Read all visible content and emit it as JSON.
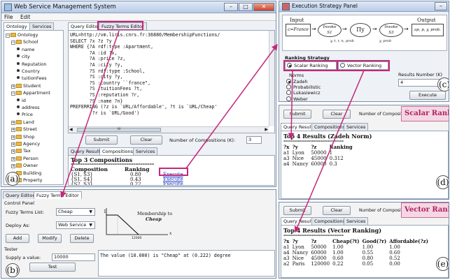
{
  "main_window": {
    "title": "Web Service Management System",
    "menu": [
      "File",
      "Edit"
    ],
    "left_tabs": [
      "Ontology",
      "Services"
    ],
    "tree": [
      {
        "label": "Ontology",
        "level": 0,
        "kind": "folder"
      },
      {
        "label": "School",
        "level": 1,
        "kind": "folder"
      },
      {
        "label": "name",
        "level": 2,
        "kind": "leaf"
      },
      {
        "label": "city",
        "level": 2,
        "kind": "leaf"
      },
      {
        "label": "Reputation",
        "level": 2,
        "kind": "leaf"
      },
      {
        "label": "Country",
        "level": 2,
        "kind": "leaf"
      },
      {
        "label": "tuitionFees",
        "level": 2,
        "kind": "leaf"
      },
      {
        "label": "Student",
        "level": 1,
        "kind": "folder"
      },
      {
        "label": "Appartment",
        "level": 1,
        "kind": "folder"
      },
      {
        "label": "id",
        "level": 2,
        "kind": "leaf"
      },
      {
        "label": "address",
        "level": 2,
        "kind": "leaf"
      },
      {
        "label": "Price",
        "level": 2,
        "kind": "leaf"
      },
      {
        "label": "Land",
        "level": 1,
        "kind": "folder"
      },
      {
        "label": "Street",
        "level": 1,
        "kind": "folder"
      },
      {
        "label": "Shop",
        "level": 1,
        "kind": "folder"
      },
      {
        "label": "Agency",
        "level": 1,
        "kind": "folder"
      },
      {
        "label": "Tax",
        "level": 1,
        "kind": "folder"
      },
      {
        "label": "Person",
        "level": 1,
        "kind": "folder"
      },
      {
        "label": "Owner",
        "level": 1,
        "kind": "folder"
      },
      {
        "label": "Building",
        "level": 1,
        "kind": "folder"
      },
      {
        "label": "Property",
        "level": 1,
        "kind": "folder"
      }
    ],
    "editor_tabs": [
      "Query Editor",
      "Fuzzy Terms Editor"
    ],
    "query_lines": [
      "URL=http://vm.liris.cnrs.fr:36880/MembershipFunctions/",
      "SELECT ?x ?z ?y",
      "WHERE {?A rdf:type :Apartment,",
      "       ?A :id ?x,",
      "       ?A :price ?z,",
      "       ?A :city ?y,",
      "       ?S rdf:type :School,",
      "       ?S :city ?y,",
      "       ?S :country ``france\",",
      "       ?S :tuitionFees ?t,",
      "       ?S :reputation ?r,",
      "       ?S :name ?n}",
      "PREFERRING (?z is `URL/Affordable', ?t is `URL/Cheap'",
      "        ?r is `URL/Good')"
    ],
    "hscroll_label": "III",
    "submit_label": "Submit",
    "clear_label": "Clear",
    "num_comp_label": "Number of Compositions (K):",
    "num_comp_value": "3",
    "result_tabs": [
      "Query Results",
      "Compositions",
      "Services"
    ],
    "compositions": {
      "title": "Top 3 Compositions",
      "rule": "====================================",
      "col_composition": "Composition",
      "col_ranking": "Ranking",
      "rows": [
        {
          "composition": "{S1, S3}",
          "ranking": "0.80",
          "action": "Execute"
        },
        {
          "composition": "{S1, S4}",
          "ranking": "0.43",
          "action": "Execute"
        },
        {
          "composition": "{S2, S3}",
          "ranking": "0.22",
          "action": "Execute"
        }
      ]
    },
    "marker": "(a)"
  },
  "fuzzy_panel": {
    "tabs": [
      "Query Editor",
      "Fuzzy Terms Editor"
    ],
    "control_panel_label": "Control Panel",
    "list_label": "Fuzzy Terms List:",
    "list_value": "Cheap",
    "deploy_label": "Deploy As:",
    "deploy_value": "Web Service",
    "add_label": "Add",
    "modify_label": "Modify",
    "delete_label": "Delete",
    "membership_label": "Membership to",
    "membership_term": "Cheap",
    "axis_y": "1",
    "axis_x": "x",
    "axis_tick": "12000",
    "tester_label": "Tester",
    "supply_label": "Supply a value:",
    "supply_value": "10000",
    "test_label": "Test",
    "test_output": "The value (10.000) is \"Cheap\" at (0.222) degree",
    "marker": "(b)"
  },
  "exec_panel": {
    "title": "Execution Strategy Panel",
    "input_label": "Input",
    "input_value": "c=France",
    "invoke1": "Invoke",
    "s1": "S1",
    "proj_label": "Πy",
    "invoke2": "Invoke",
    "s3": "S3",
    "output_label": "Output",
    "output_value": "ap, p, y, prob.",
    "flow1": "y, t, r, n, prob",
    "flow2": "y, prob",
    "ranking_strategy_label": "Ranking Strategy",
    "scalar_label": "Scalar Ranking",
    "vector_label": "Vector Ranking",
    "norms_label": "Norms",
    "norms": [
      "Zadeh",
      "Probabilistic",
      "Lukasiewicz",
      "Weber"
    ],
    "results_number_label": "Results Number (K)",
    "results_number_value": "4",
    "execute_label": "Execute",
    "marker": "(c)"
  },
  "scalar_panel": {
    "submit_label": "Submit",
    "clear_label": "Clear",
    "num_comp_label": "Number of Compositions",
    "banner": "Scalar Ranking",
    "tabs": [
      "Query Results",
      "Compositions",
      "Services"
    ],
    "title": "Top 4 Results (Zadeh Norm)",
    "rule": "==========================",
    "headers": [
      "?x",
      "?y",
      "?z",
      "Ranking"
    ],
    "rows": [
      [
        "a1",
        "Lyon",
        "50000",
        "1"
      ],
      [
        "a3",
        "Nice",
        "45000",
        "0.312"
      ],
      [
        "a4",
        "Nancy",
        "60000",
        "0.3"
      ]
    ],
    "marker": "(d)"
  },
  "vector_panel": {
    "submit_label": "Submit",
    "clear_label": "Clear",
    "num_comp_label": "Number of Compositions",
    "banner": "Vector Ranking",
    "tabs": [
      "Query Results",
      "Compositions",
      "Services"
    ],
    "title": "Top 4 Results (Vector Ranking)",
    "rule": "==========================",
    "headers": [
      "?x",
      "?y",
      "?z",
      "Cheap(?t)",
      "Good(?r)",
      "Affordable(?z)"
    ],
    "rows": [
      [
        "a1",
        "Lyon",
        "50000",
        "1.00",
        "1.00",
        "1.00"
      ],
      [
        "a4",
        "Nancy",
        "60000",
        "1.00",
        "0.55",
        "0.60"
      ],
      [
        "a3",
        "Nice",
        "45000",
        "0.60",
        "0.80",
        "0.52"
      ],
      [
        "a2",
        "Paris",
        "120000",
        "0.22",
        "0.05",
        "0.00"
      ]
    ],
    "marker": "(e)"
  },
  "colors": {
    "accent": "#c4287a",
    "link": "#1a2cc4",
    "banner_bg": "#f4d7e3"
  }
}
